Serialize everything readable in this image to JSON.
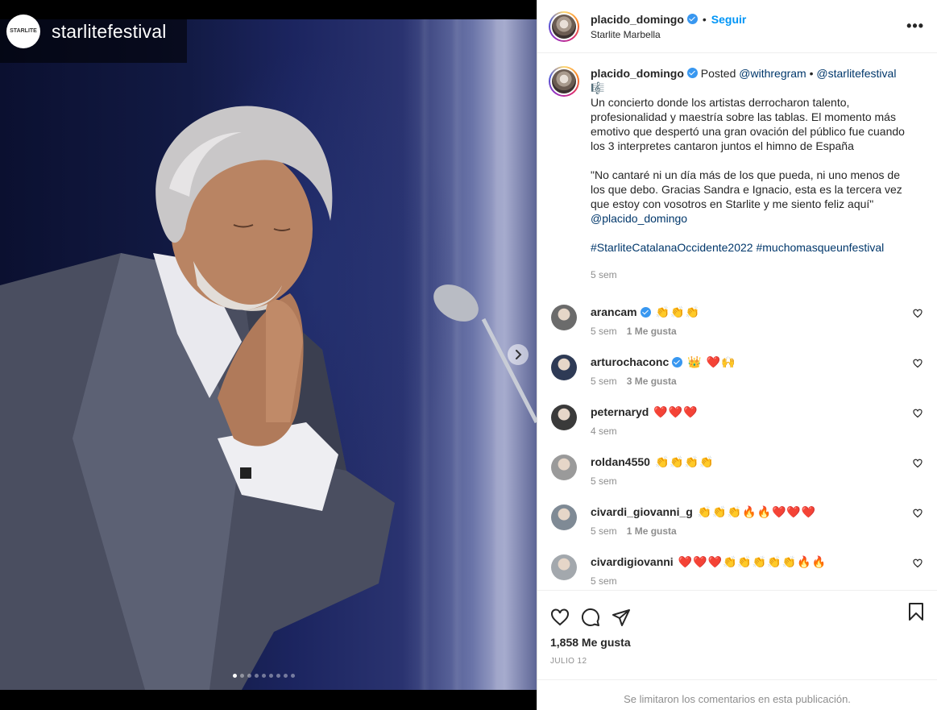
{
  "media": {
    "watermark_logo_text": "STARLITE",
    "watermark_handle": "starlitefestival",
    "carousel_total": 9,
    "carousel_active_index": 0
  },
  "header": {
    "username": "placido_domingo",
    "separator": "•",
    "follow_label": "Seguir",
    "location": "Starlite Marbella",
    "more_label": "•••"
  },
  "caption": {
    "username": "placido_domingo",
    "posted": "Posted",
    "via": "@withregram",
    "sep": "•",
    "source": "@starlitefestival",
    "emoji": "🎼",
    "paragraph1": "Un concierto donde los artistas derrocharon talento, profesionalidad y maestría sobre las tablas. El momento más emotivo que despertó una gran ovación del público fue cuando los 3 interpretes cantaron juntos el himno de España",
    "quote": "\"No cantaré ni un día más de los que pueda, ni uno menos de los que debo. Gracias Sandra e Ignacio, esta es la tercera vez que estoy con vosotros en Starlite y me siento feliz aquí\"",
    "mention": "@placido_domingo",
    "hashtags": "#StarliteCatalanaOccidente2022 #muchomasqueunfestival",
    "time": "5 sem"
  },
  "comments": [
    {
      "user": "arancam",
      "verified": true,
      "text": "👏👏👏",
      "time": "5 sem",
      "likes": "1 Me gusta",
      "avatar_color": "#6b6b6b"
    },
    {
      "user": "arturochaconc",
      "verified": true,
      "text": "👑 ❤️🙌",
      "time": "5 sem",
      "likes": "3 Me gusta",
      "avatar_color": "#2e3a55"
    },
    {
      "user": "peternaryd",
      "verified": false,
      "text": "❤️❤️❤️",
      "time": "4 sem",
      "likes": "",
      "avatar_color": "#3a3a3a"
    },
    {
      "user": "roldan4550",
      "verified": false,
      "text": "👏👏👏👏",
      "time": "5 sem",
      "likes": "",
      "avatar_color": "#9a9a9a"
    },
    {
      "user": "civardi_giovanni_g",
      "verified": false,
      "text": "👏👏👏🔥🔥❤️❤️❤️",
      "time": "5 sem",
      "likes": "1 Me gusta",
      "avatar_color": "#7f8a95"
    },
    {
      "user": "civardigiovanni",
      "verified": false,
      "text": "❤️❤️❤️👏👏👏👏👏🔥🔥",
      "time": "5 sem",
      "likes": "",
      "avatar_color": "#a3a8ad"
    }
  ],
  "actions": {
    "likes_count": "1,858 Me gusta",
    "date": "JULIO 12",
    "comments_limited": "Se limitaron los comentarios en esta publicación."
  },
  "icons": [
    "next-arrow-icon",
    "verified-icon",
    "more-icon",
    "heart-icon",
    "comment-icon",
    "share-icon",
    "bookmark-icon"
  ]
}
